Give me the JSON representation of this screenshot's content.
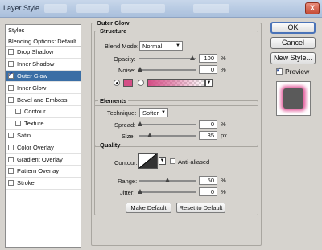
{
  "window": {
    "title": "Layer Style",
    "close_label": "X"
  },
  "styles_panel": {
    "header": "Styles",
    "blending_options": "Blending Options: Default",
    "items": [
      {
        "label": "Drop Shadow",
        "checked": false,
        "active": false,
        "sub": false
      },
      {
        "label": "Inner Shadow",
        "checked": false,
        "active": false,
        "sub": false
      },
      {
        "label": "Outer Glow",
        "checked": true,
        "active": true,
        "sub": false
      },
      {
        "label": "Inner Glow",
        "checked": false,
        "active": false,
        "sub": false
      },
      {
        "label": "Bevel and Emboss",
        "checked": false,
        "active": false,
        "sub": false
      },
      {
        "label": "Contour",
        "checked": false,
        "active": false,
        "sub": true
      },
      {
        "label": "Texture",
        "checked": false,
        "active": false,
        "sub": true
      },
      {
        "label": "Satin",
        "checked": false,
        "active": false,
        "sub": false
      },
      {
        "label": "Color Overlay",
        "checked": false,
        "active": false,
        "sub": false
      },
      {
        "label": "Gradient Overlay",
        "checked": false,
        "active": false,
        "sub": false
      },
      {
        "label": "Pattern Overlay",
        "checked": false,
        "active": false,
        "sub": false
      },
      {
        "label": "Stroke",
        "checked": false,
        "active": false,
        "sub": false
      }
    ]
  },
  "outer_glow": {
    "title": "Outer Glow",
    "structure": {
      "legend": "Structure",
      "blend_mode_label": "Blend Mode:",
      "blend_mode_value": "Normal",
      "opacity_label": "Opacity:",
      "opacity_value": "100",
      "noise_label": "Noise:",
      "noise_value": "0",
      "percent": "%",
      "glow_color": "#d44e86"
    },
    "elements": {
      "legend": "Elements",
      "technique_label": "Technique:",
      "technique_value": "Softer",
      "spread_label": "Spread:",
      "spread_value": "0",
      "size_label": "Size:",
      "size_value": "35",
      "percent": "%",
      "px": "px"
    },
    "quality": {
      "legend": "Quality",
      "contour_label": "Contour:",
      "anti_aliased_label": "Anti-aliased",
      "range_label": "Range:",
      "range_value": "50",
      "jitter_label": "Jitter:",
      "jitter_value": "0",
      "percent": "%"
    },
    "make_default": "Make Default",
    "reset_default": "Reset to Default"
  },
  "buttons": {
    "ok": "OK",
    "cancel": "Cancel",
    "new_style": "New Style...",
    "preview_label": "Preview",
    "preview_checked": true
  }
}
